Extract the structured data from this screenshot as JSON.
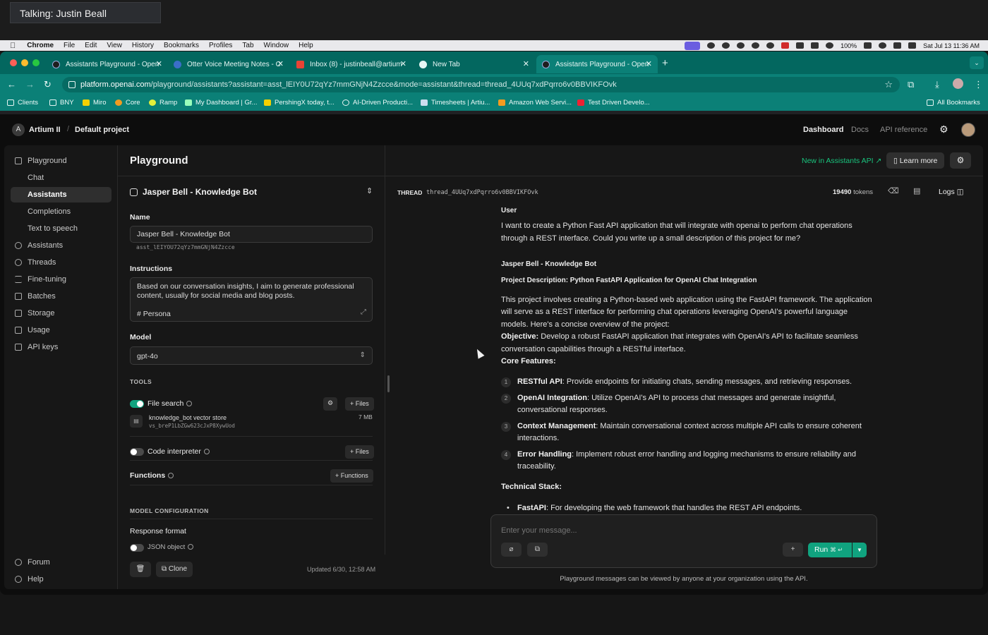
{
  "zoom": {
    "talking": "Talking: Justin Beall"
  },
  "menubar": {
    "app": "Chrome",
    "items": [
      "File",
      "Edit",
      "View",
      "History",
      "Bookmarks",
      "Profiles",
      "Tab",
      "Window",
      "Help"
    ],
    "battery": "100%",
    "datetime": "Sat Jul 13  11:36 AM"
  },
  "tabs": [
    {
      "title": "Assistants Playground - Open"
    },
    {
      "title": "Otter Voice Meeting Notes - C"
    },
    {
      "title": "Inbox (8) - justinbeall@artium"
    },
    {
      "title": "New Tab"
    },
    {
      "title": "Assistants Playground - Open"
    }
  ],
  "address": {
    "host": "platform.openai.com",
    "path": "/playground/assistants?assistant=asst_lEIY0U72qYz7mmGNjN4Zzcce&mode=assistant&thread=thread_4UUq7xdPqrro6v0BBVIKFOvk"
  },
  "bookmarks": [
    "Clients",
    "BNY",
    "Miro",
    "Core",
    "Ramp",
    "My Dashboard | Gr...",
    "PershingX today, t...",
    "AI-Driven Producti...",
    "Timesheets | Artiu...",
    "Amazon Web Servi...",
    "Test Driven Develo..."
  ],
  "bookmarks_all": "All Bookmarks",
  "topnav": {
    "org_initial": "A",
    "org": "Artium II",
    "separator": "/",
    "project": "Default project",
    "links": [
      "Dashboard",
      "Docs",
      "API reference"
    ]
  },
  "sidebar": {
    "items": [
      {
        "label": "Playground"
      },
      {
        "label": "Chat"
      },
      {
        "label": "Assistants"
      },
      {
        "label": "Completions"
      },
      {
        "label": "Text to speech"
      },
      {
        "label": "Assistants"
      },
      {
        "label": "Threads"
      },
      {
        "label": "Fine-tuning"
      },
      {
        "label": "Batches"
      },
      {
        "label": "Storage"
      },
      {
        "label": "Usage"
      },
      {
        "label": "API keys"
      }
    ],
    "forum": "Forum",
    "help": "Help"
  },
  "config": {
    "page_title": "Playground",
    "assistant_title": "Jasper Bell - Knowledge Bot",
    "name_label": "Name",
    "name_value": "Jasper Bell - Knowledge Bot",
    "assistant_id": "asst_lEIYOU72qYz7mmGNjN4Zzcce",
    "instructions_label": "Instructions",
    "instructions_text": "Based on our conversation insights, I aim to generate professional content, usually for social media and blog posts.",
    "instructions_persona": "# Persona",
    "model_label": "Model",
    "model_value": "gpt-4o",
    "tools_cap": "TOOLS",
    "file_search": "File search",
    "files_btn": "+ Files",
    "vector_store_name": "knowledge_bot vector store",
    "vector_store_id": "vs_breP1LbZGw623cJxP8XywUod",
    "vector_store_size": "7 MB",
    "code_interpreter": "Code interpreter",
    "functions": "Functions",
    "functions_btn": "+ Functions",
    "model_config_cap": "MODEL CONFIGURATION",
    "response_format": "Response format",
    "json_object": "JSON object",
    "clone_btn": "Clone",
    "updated": "Updated 6/30, 12:58 AM"
  },
  "thread": {
    "new_in_api": "New in Assistants API ↗",
    "learn_more": "Learn more",
    "label": "THREAD",
    "id": "thread_4UUq7xdPqrro6v0BBVIKFOvk",
    "token_count": "19490",
    "token_unit": "tokens",
    "logs": "Logs",
    "user_role": "User",
    "user_msg": "I want to create a Python Fast API application that will integrate with openai to perform chat operations through a REST interface. Could you write up a small description of this project for me?",
    "bot_role": "Jasper Bell - Knowledge Bot",
    "project_title": "Project Description: Python FastAPI Application for OpenAI Chat Integration",
    "intro": "This project involves creating a Python-based web application using the FastAPI framework. The application will serve as a REST interface for performing chat operations leveraging OpenAI's powerful language models. Here's a concise overview of the project:",
    "objective_label": "Objective:",
    "objective_text": " Develop a robust FastAPI application that integrates with OpenAI's API to facilitate seamless conversation capabilities through a RESTful interface.",
    "core_label": "Core Features:",
    "features": [
      {
        "num": "1",
        "title": "RESTful API",
        "text": ": Provide endpoints for initiating chats, sending messages, and retrieving responses."
      },
      {
        "num": "2",
        "title": "OpenAI Integration",
        "text": ": Utilize OpenAI's API to process chat messages and generate insightful, conversational responses."
      },
      {
        "num": "3",
        "title": "Context Management",
        "text": ": Maintain conversational context across multiple API calls to ensure coherent interactions."
      },
      {
        "num": "4",
        "title": "Error Handling",
        "text": ": Implement robust error handling and logging mechanisms to ensure reliability and traceability."
      }
    ],
    "stack_label": "Technical Stack:",
    "stack": [
      {
        "title": "FastAPI",
        "text": ": For developing the web framework that handles the REST API endpoints."
      }
    ],
    "composer_placeholder": "Enter your message...",
    "run_label": "Run",
    "run_shortcut": "⌘ ↵",
    "notice": "Playground messages can be viewed by anyone at your organization using the API."
  },
  "colors": {
    "accent": "#10a37f",
    "chrome_tab": "#0b8077",
    "chrome_strip": "#03675f"
  }
}
